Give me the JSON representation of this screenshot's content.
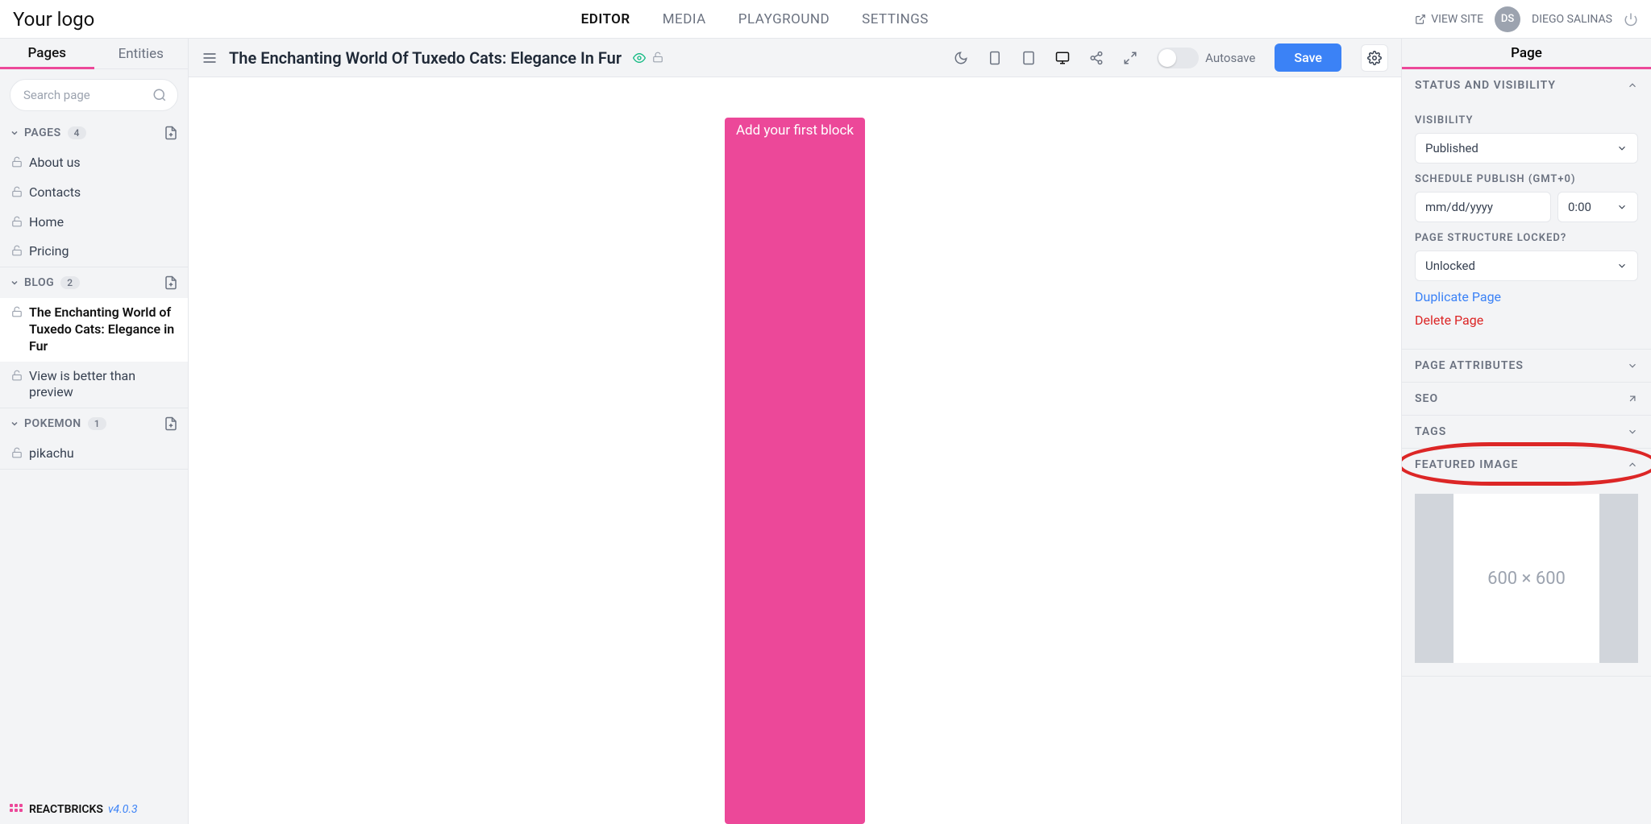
{
  "header": {
    "logo": "Your logo",
    "nav": {
      "editor": "EDITOR",
      "media": "MEDIA",
      "playground": "PLAYGROUND",
      "settings": "SETTINGS"
    },
    "viewSite": "VIEW SITE",
    "userInitials": "DS",
    "userName": "DIEGO SALINAS"
  },
  "sidebar": {
    "tabs": {
      "pages": "Pages",
      "entities": "Entities"
    },
    "searchPlaceholder": "Search page",
    "groups": {
      "pages": {
        "label": "PAGES",
        "count": "4",
        "items": [
          "About us",
          "Contacts",
          "Home",
          "Pricing"
        ]
      },
      "blog": {
        "label": "BLOG",
        "count": "2",
        "items": [
          "The Enchanting World of Tuxedo Cats: Elegance in Fur",
          "View is better than preview"
        ]
      },
      "pokemon": {
        "label": "POKEMON",
        "count": "1",
        "items": [
          "pikachu"
        ]
      }
    },
    "brand": "REACTBRICKS",
    "version": "v4.0.3"
  },
  "editor": {
    "title": "The Enchanting World Of Tuxedo Cats: Elegance In Fur",
    "autosave": "Autosave",
    "save": "Save",
    "addBlock": "Add your first block"
  },
  "inspector": {
    "tab": "Page",
    "sections": {
      "status": {
        "title": "STATUS AND VISIBILITY",
        "visibility": {
          "label": "VISIBILITY",
          "value": "Published"
        },
        "schedule": {
          "label": "SCHEDULE PUBLISH (GMT+0)",
          "date": "mm/dd/yyyy",
          "time": "0:00"
        },
        "locked": {
          "label": "PAGE STRUCTURE LOCKED?",
          "value": "Unlocked"
        },
        "duplicate": "Duplicate Page",
        "delete": "Delete Page"
      },
      "attributes": "PAGE ATTRIBUTES",
      "seo": "SEO",
      "tags": "TAGS",
      "featured": {
        "title": "FEATURED IMAGE",
        "placeholder": "600 × 600"
      }
    }
  }
}
